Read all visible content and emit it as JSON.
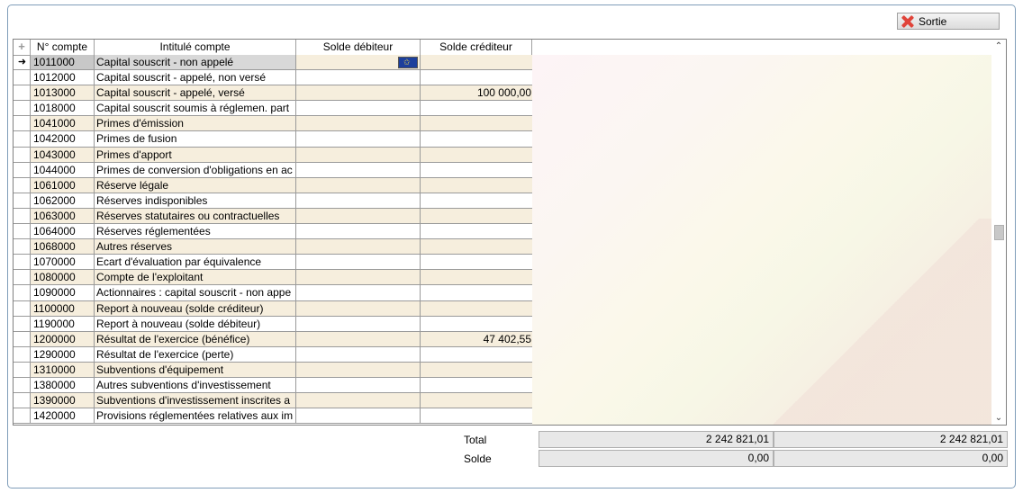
{
  "toolbar": {
    "exit_label": "Sortie",
    "exit_icon": "close-x-icon"
  },
  "table": {
    "columns": [
      "N° compte",
      "Intitulé compte",
      "Solde débiteur",
      "Solde créditeur"
    ],
    "rows": [
      {
        "num": "1011000",
        "label": "Capital souscrit - non appelé",
        "debit": "",
        "credit": ""
      },
      {
        "num": "1012000",
        "label": "Capital souscrit - appelé, non versé",
        "debit": "",
        "credit": ""
      },
      {
        "num": "1013000",
        "label": "Capital souscrit - appelé, versé",
        "debit": "",
        "credit": "100 000,00"
      },
      {
        "num": "1018000",
        "label": "Capital souscrit soumis à réglemen. part",
        "debit": "",
        "credit": ""
      },
      {
        "num": "1041000",
        "label": "Primes d'émission",
        "debit": "",
        "credit": ""
      },
      {
        "num": "1042000",
        "label": "Primes de fusion",
        "debit": "",
        "credit": ""
      },
      {
        "num": "1043000",
        "label": "Primes d'apport",
        "debit": "",
        "credit": ""
      },
      {
        "num": "1044000",
        "label": "Primes de conversion d'obligations en ac",
        "debit": "",
        "credit": ""
      },
      {
        "num": "1061000",
        "label": "Réserve légale",
        "debit": "",
        "credit": ""
      },
      {
        "num": "1062000",
        "label": "Réserves indisponibles",
        "debit": "",
        "credit": ""
      },
      {
        "num": "1063000",
        "label": "Réserves statutaires ou contractuelles",
        "debit": "",
        "credit": ""
      },
      {
        "num": "1064000",
        "label": "Réserves réglementées",
        "debit": "",
        "credit": ""
      },
      {
        "num": "1068000",
        "label": "Autres réserves",
        "debit": "",
        "credit": ""
      },
      {
        "num": "1070000",
        "label": "Ecart d'évaluation par équivalence",
        "debit": "",
        "credit": ""
      },
      {
        "num": "1080000",
        "label": "Compte de l'exploitant",
        "debit": "",
        "credit": ""
      },
      {
        "num": "1090000",
        "label": "Actionnaires : capital souscrit - non appe",
        "debit": "",
        "credit": ""
      },
      {
        "num": "1100000",
        "label": "Report à nouveau (solde créditeur)",
        "debit": "",
        "credit": ""
      },
      {
        "num": "1190000",
        "label": "Report à nouveau (solde débiteur)",
        "debit": "",
        "credit": ""
      },
      {
        "num": "1200000",
        "label": "Résultat de l'exercice (bénéfice)",
        "debit": "",
        "credit": "47 402,55"
      },
      {
        "num": "1290000",
        "label": "Résultat de l'exercice (perte)",
        "debit": "",
        "credit": ""
      },
      {
        "num": "1310000",
        "label": "Subventions d'équipement",
        "debit": "",
        "credit": ""
      },
      {
        "num": "1380000",
        "label": "Autres subventions d'investissement",
        "debit": "",
        "credit": ""
      },
      {
        "num": "1390000",
        "label": "Subventions d'investissement inscrites a",
        "debit": "",
        "credit": ""
      },
      {
        "num": "1420000",
        "label": "Provisions réglementées relatives aux im",
        "debit": "",
        "credit": ""
      }
    ]
  },
  "totals": {
    "total_label": "Total",
    "total_debit": "2 242 821,01",
    "total_credit": "2 242 821,01",
    "solde_label": "Solde",
    "solde_debit": "0,00",
    "solde_credit": "0,00"
  }
}
